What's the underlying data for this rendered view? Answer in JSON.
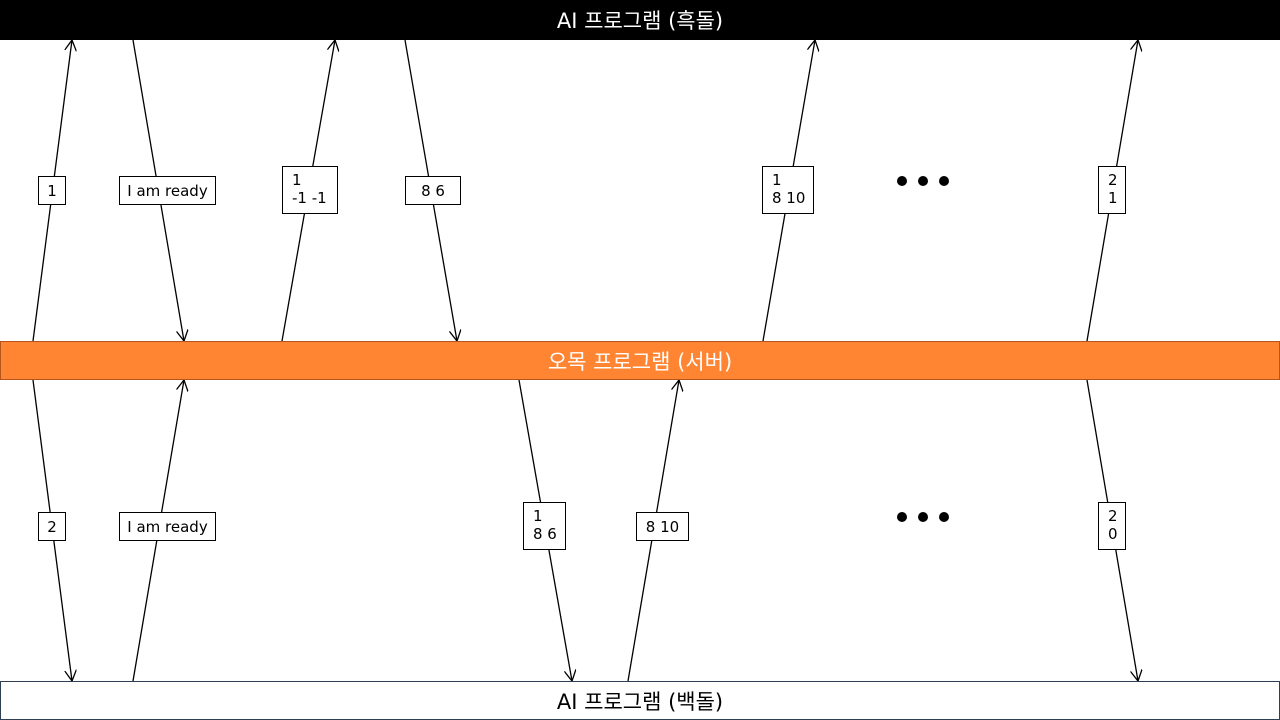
{
  "colors": {
    "black_bar": "#000000",
    "server_bar": "#ff8533",
    "white_bar": "#ffffff"
  },
  "bars": {
    "black_player": "AI 프로그램 (흑돌)",
    "server": "오목 프로그램 (서버)",
    "white_player": "AI 프로그램 (백돌)"
  },
  "messages_top": [
    {
      "id": "t1",
      "direction": "to-black",
      "lines": [
        "1"
      ]
    },
    {
      "id": "t2",
      "direction": "to-server",
      "lines": [
        "I am ready"
      ]
    },
    {
      "id": "t3",
      "direction": "to-black",
      "lines": [
        "1",
        "-1 -1"
      ]
    },
    {
      "id": "t4",
      "direction": "to-server",
      "lines": [
        "8 6"
      ]
    },
    {
      "id": "t5",
      "direction": "to-black",
      "lines": [
        "1",
        "8 10"
      ]
    },
    {
      "id": "t6",
      "direction": "to-black",
      "lines": [
        "2",
        "1"
      ]
    }
  ],
  "messages_bottom": [
    {
      "id": "b1",
      "direction": "to-white",
      "lines": [
        "2"
      ]
    },
    {
      "id": "b2",
      "direction": "to-server",
      "lines": [
        "I am ready"
      ]
    },
    {
      "id": "b3",
      "direction": "to-white",
      "lines": [
        "1",
        "8 6"
      ]
    },
    {
      "id": "b4",
      "direction": "to-server",
      "lines": [
        "8 10"
      ]
    },
    {
      "id": "b5",
      "direction": "to-white",
      "lines": [
        "2",
        "0"
      ]
    }
  ],
  "ellipsis": {
    "top": "more-messages",
    "bottom": "more-messages"
  }
}
